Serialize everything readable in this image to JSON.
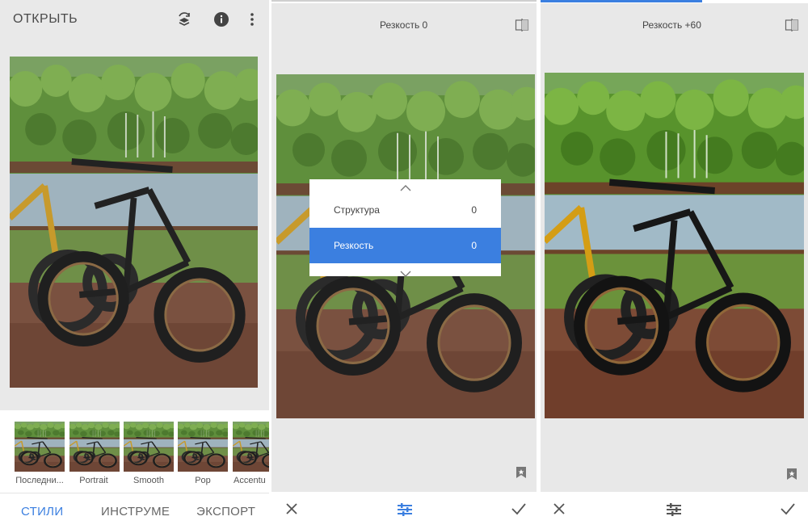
{
  "panel1": {
    "open_label": "ОТКРЫТЬ",
    "icons": [
      "layers-refresh-icon",
      "info-icon",
      "more-vert-icon"
    ],
    "styles": [
      {
        "label": "Последни..."
      },
      {
        "label": "Portrait"
      },
      {
        "label": "Smooth"
      },
      {
        "label": "Pop"
      },
      {
        "label": "Accentu"
      }
    ],
    "tabs": [
      {
        "label": "СТИЛИ",
        "active": true
      },
      {
        "label": "ИНСТРУМЕ",
        "active": false
      },
      {
        "label": "ЭКСПОРТ",
        "active": false
      }
    ]
  },
  "panel2": {
    "header": "Резкость 0",
    "menu": {
      "items": [
        {
          "label": "Структура",
          "value": "0",
          "active": false
        },
        {
          "label": "Резкость",
          "value": "0",
          "active": true
        }
      ]
    }
  },
  "panel3": {
    "header": "Резкость +60"
  },
  "colors": {
    "accent": "#3b7fe0",
    "panel_bg": "#e8e8e8"
  }
}
